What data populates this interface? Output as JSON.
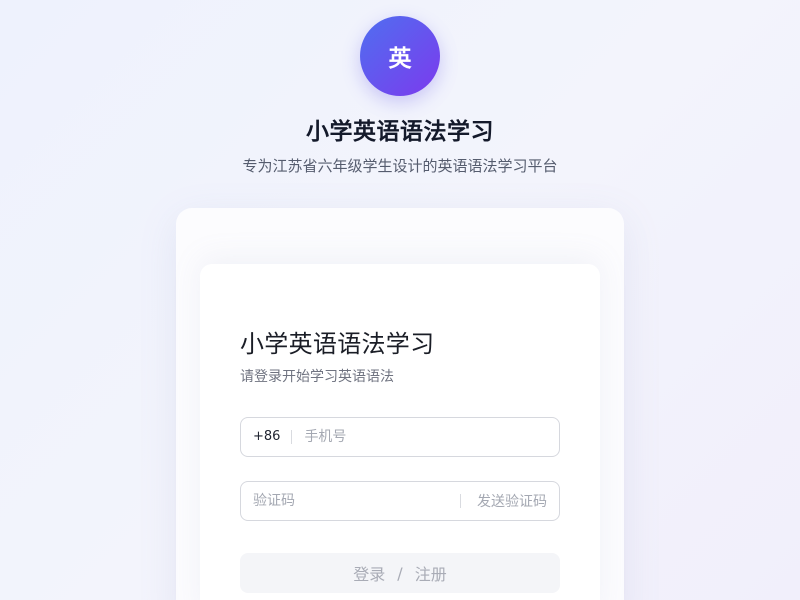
{
  "logo": {
    "char": "英",
    "gradient": [
      "#4f6ff0",
      "#7c3aed"
    ]
  },
  "header": {
    "title": "小学英语语法学习",
    "subtitle": "专为江苏省六年级学生设计的英语语法学习平台"
  },
  "form": {
    "title": "小学英语语法学习",
    "subtitle": "请登录开始学习英语语法",
    "phone": {
      "prefix": "+86",
      "placeholder": "手机号",
      "value": ""
    },
    "code": {
      "placeholder": "验证码",
      "value": "",
      "send_label": "发送验证码"
    },
    "submit": {
      "login_label": "登录",
      "separator": "/",
      "register_label": "注册"
    }
  }
}
